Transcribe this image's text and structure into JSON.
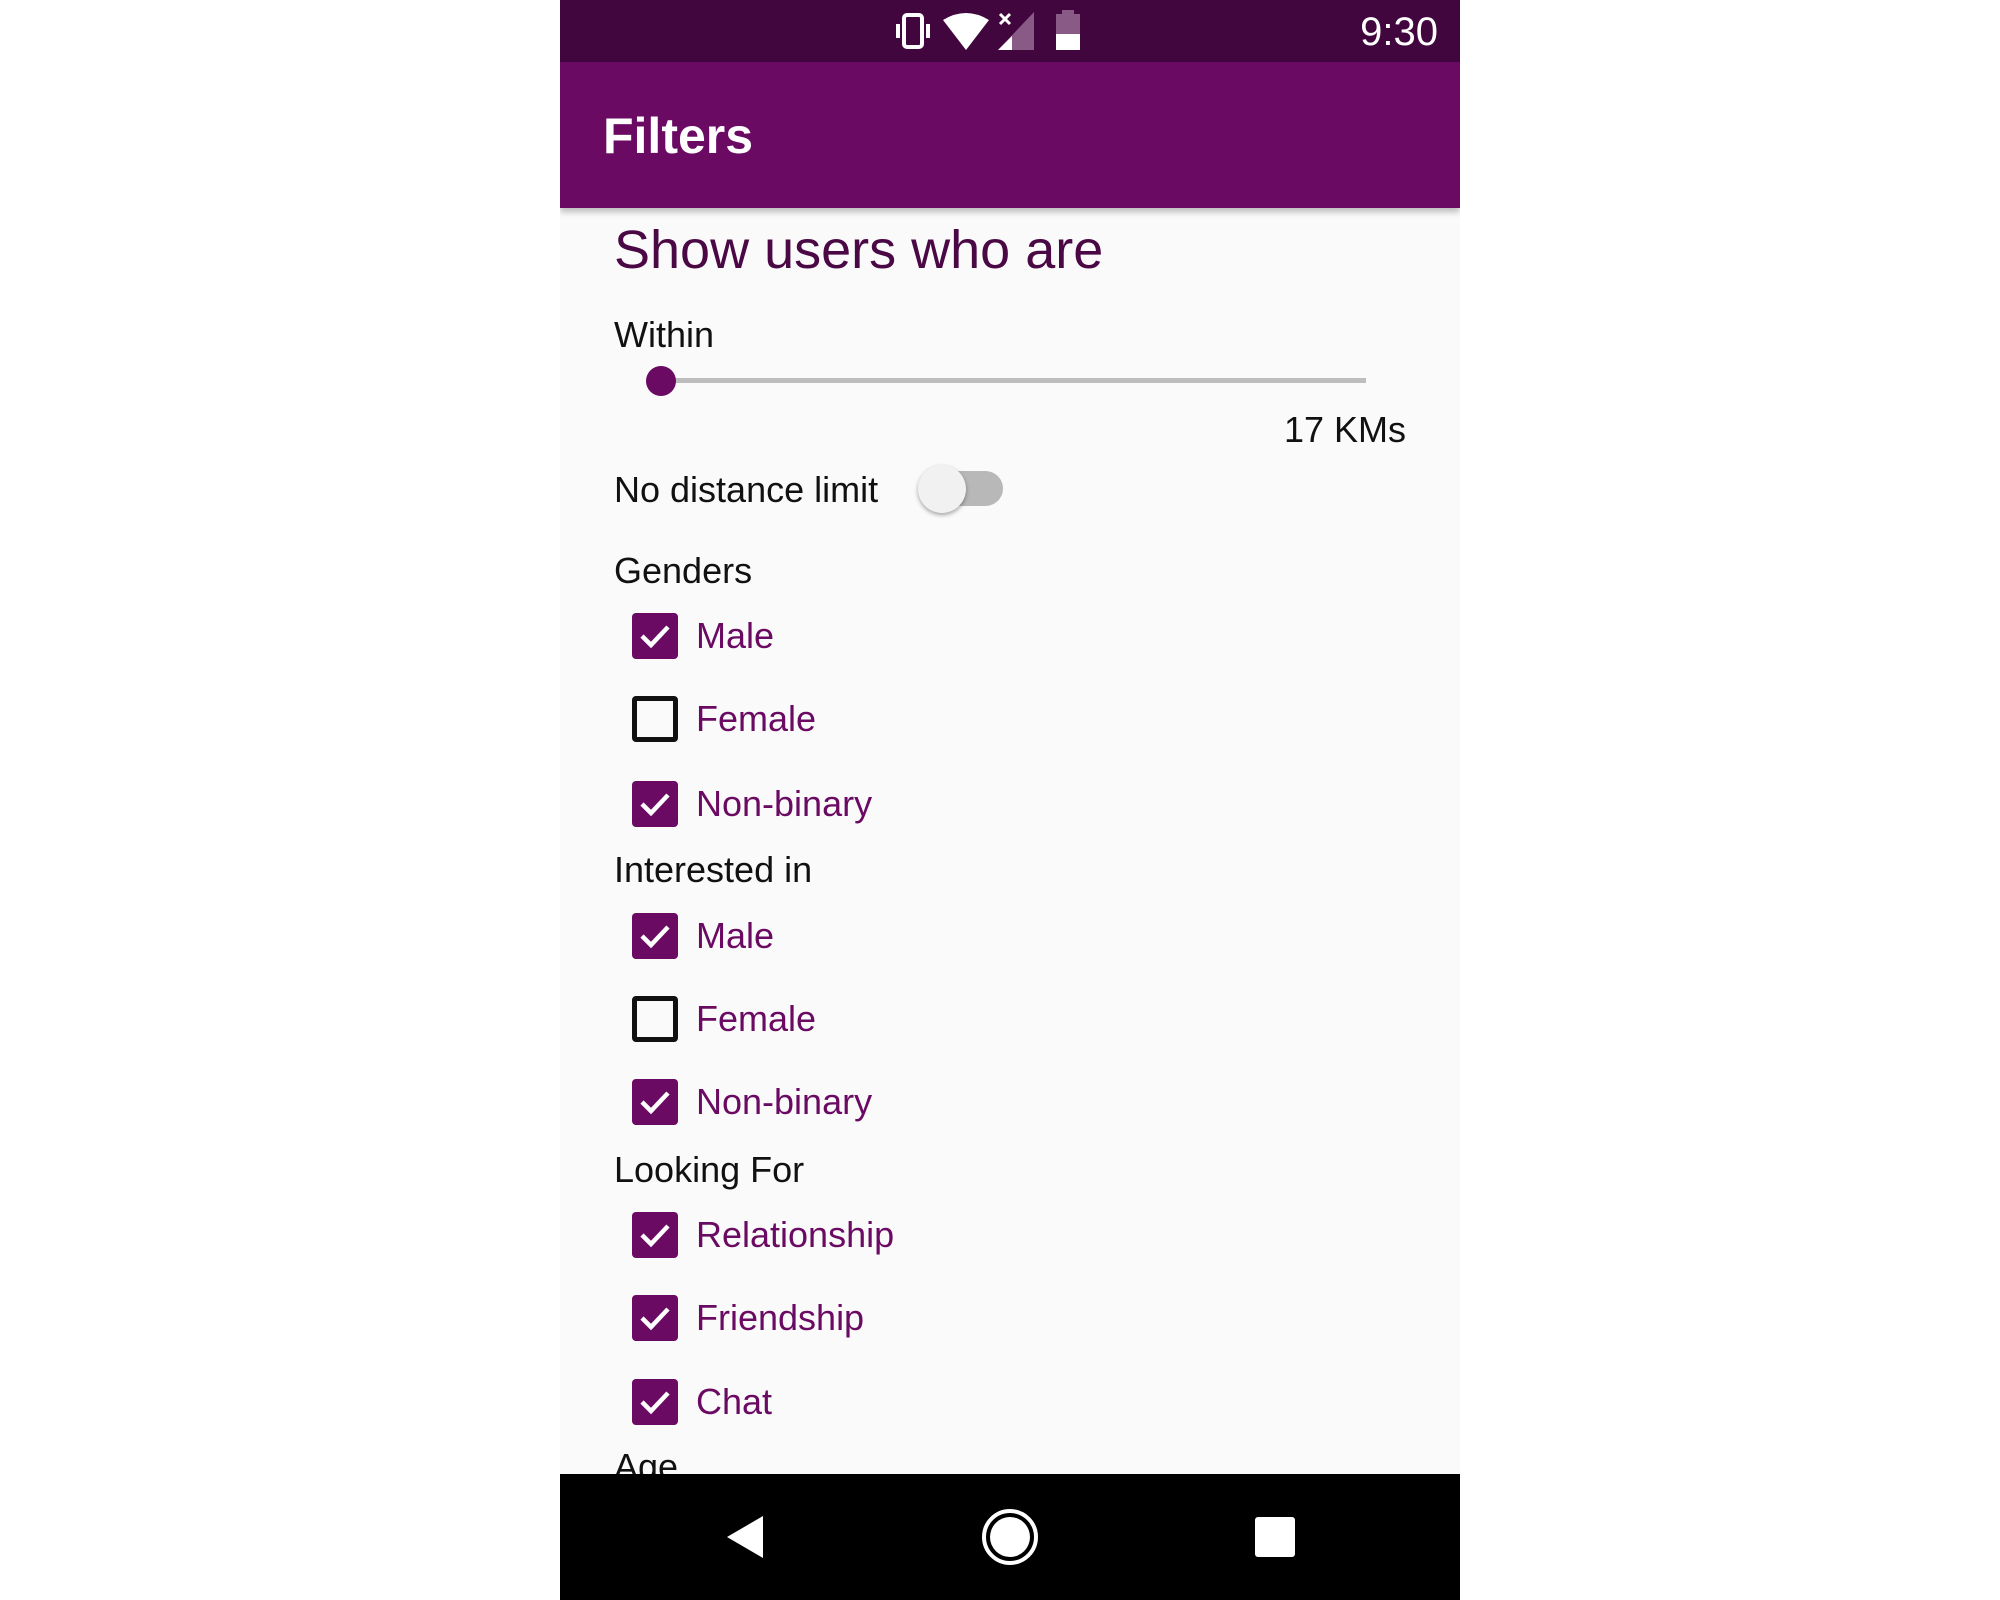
{
  "status_bar": {
    "time": "9:30",
    "icons": [
      "vibrate-icon",
      "wifi-icon",
      "signal-no-data-icon",
      "battery-icon"
    ]
  },
  "app_bar": {
    "title": "Filters"
  },
  "content": {
    "heading": "Show users who are",
    "within_label": "Within",
    "distance": {
      "value": 17,
      "unit_text": "17 KMs",
      "slider_fraction": 0.0
    },
    "no_limit": {
      "label": "No distance limit",
      "on": false
    },
    "genders": {
      "label": "Genders",
      "options": [
        {
          "label": "Male",
          "checked": true
        },
        {
          "label": "Female",
          "checked": false
        },
        {
          "label": "Non-binary",
          "checked": true
        }
      ]
    },
    "interested_in": {
      "label": "Interested in",
      "options": [
        {
          "label": "Male",
          "checked": true
        },
        {
          "label": "Female",
          "checked": false
        },
        {
          "label": "Non-binary",
          "checked": true
        }
      ]
    },
    "looking_for": {
      "label": "Looking For",
      "options": [
        {
          "label": "Relationship",
          "checked": true
        },
        {
          "label": "Friendship",
          "checked": true
        },
        {
          "label": "Chat",
          "checked": true
        }
      ]
    },
    "age_label": "Age"
  },
  "colors": {
    "primary": "#6a0a63",
    "primary_dark": "#42063f",
    "background": "#fafafa"
  },
  "nav_bar": {
    "icons": [
      "back-icon",
      "home-icon",
      "recents-icon"
    ]
  }
}
